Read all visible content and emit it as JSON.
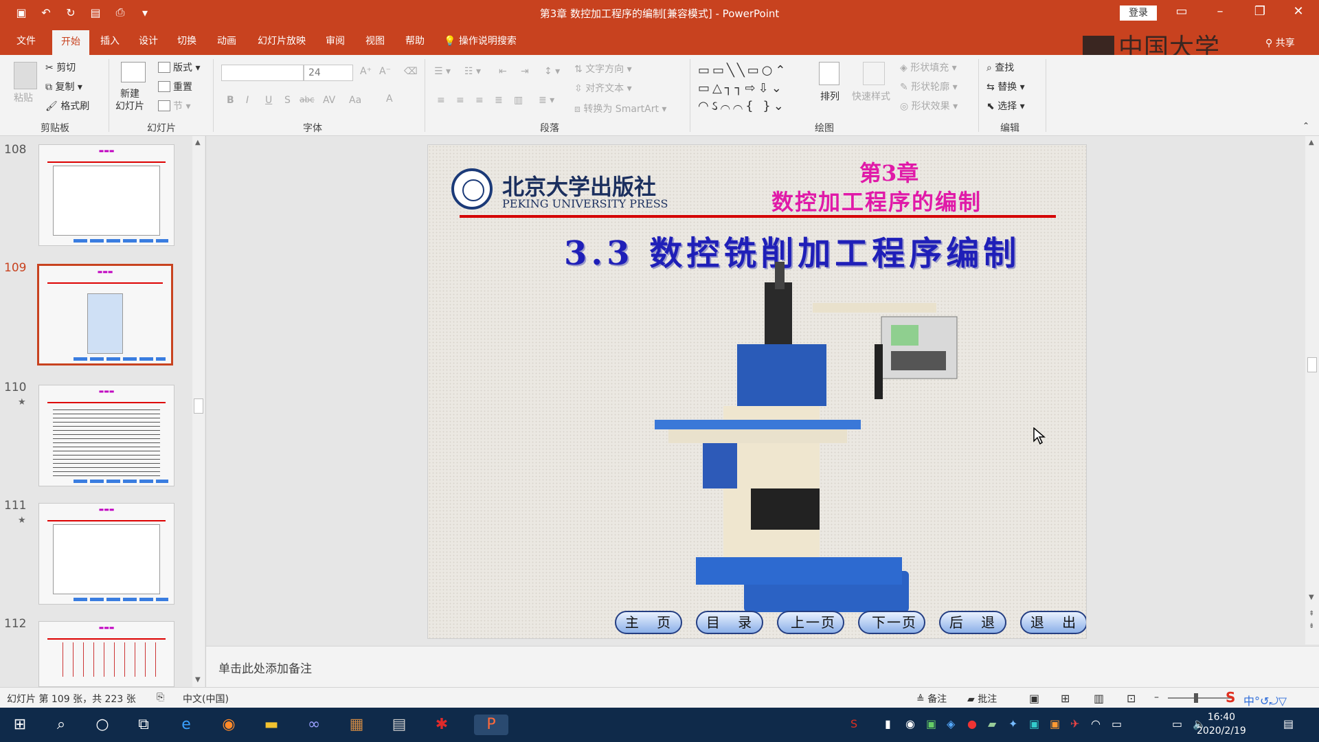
{
  "window": {
    "title": "第3章 数控加工程序的编制[兼容模式] - PowerPoint",
    "login": "登录",
    "qat_icons": [
      "save-icon",
      "undo-icon",
      "redo-icon",
      "present-icon",
      "print-icon",
      "customize-icon"
    ]
  },
  "tabs": [
    "文件",
    "开始",
    "插入",
    "设计",
    "切换",
    "动画",
    "幻灯片放映",
    "审阅",
    "视图",
    "帮助"
  ],
  "active_tab": "开始",
  "search_hint": "操作说明搜索",
  "share": "共享",
  "watermark": "中国大学MOOC",
  "ribbon": {
    "clipboard": {
      "paste": "粘贴",
      "cut": "剪切",
      "copy": "复制",
      "format_painter": "格式刷",
      "label": "剪贴板"
    },
    "slides": {
      "new_slide": "新建\n幻灯片",
      "layout": "版式",
      "reset": "重置",
      "section": "节",
      "label": "幻灯片"
    },
    "font": {
      "font_name": "",
      "font_size": "24",
      "label": "字体",
      "bold": "B",
      "italic": "I",
      "underline": "U",
      "shadow": "S",
      "strike": "abc",
      "spacing": "AV",
      "case": "Aa",
      "color": "A"
    },
    "paragraph": {
      "label": "段落",
      "text_direction": "文字方向",
      "align_text": "对齐文本",
      "smartart": "转换为 SmartArt"
    },
    "drawing": {
      "label": "绘图",
      "arrange": "排列",
      "quick_styles": "快速样式",
      "shape_fill": "形状填充",
      "shape_outline": "形状轮廓",
      "shape_effects": "形状效果"
    },
    "editing": {
      "label": "编辑",
      "find": "查找",
      "replace": "替换",
      "select": "选择"
    }
  },
  "thumbnails": [
    {
      "number": "108",
      "starred": false,
      "selected": false
    },
    {
      "number": "109",
      "starred": false,
      "selected": true
    },
    {
      "number": "110",
      "starred": true,
      "selected": false
    },
    {
      "number": "111",
      "starred": true,
      "selected": false
    },
    {
      "number": "112",
      "starred": false,
      "selected": false
    }
  ],
  "slide": {
    "publisher_cn": "北京大学出版社",
    "publisher_en": "PEKING UNIVERSITY PRESS",
    "chapter": "第3章",
    "chapter_title": "数控加工程序的编制",
    "title": "3.3 数控铣削加工程序编制",
    "nav_buttons": [
      "主 页",
      "目 录",
      "上一页",
      "下一页",
      "后 退",
      "退 出"
    ]
  },
  "notes_placeholder": "单击此处添加备注",
  "status": {
    "slide_info": "幻灯片 第 109 张，共 223 张",
    "language": "中文(中国)",
    "notes": "备注",
    "comments": "批注"
  },
  "clock": {
    "time": "16:40",
    "date": "2020/2/19"
  },
  "colors": {
    "accent": "#c8421f",
    "slide_title": "#1f1fb8",
    "chapter": "#e01aa8",
    "taskbar": "#0f2a4a"
  }
}
